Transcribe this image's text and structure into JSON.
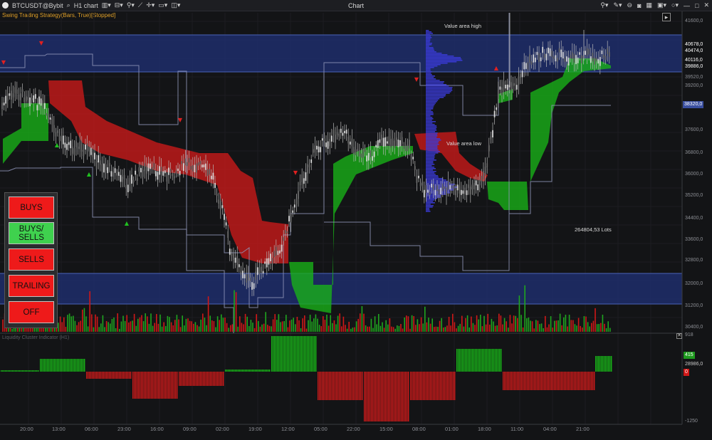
{
  "toolbar": {
    "symbol": "BTCUSDT@Bybit",
    "timeframe": "H1 chart",
    "window_title": "Chart"
  },
  "strategy_label": "Swing Trading Strategy(Bars, True)[Stopped]",
  "colors": {
    "background": "#131416",
    "buy": "#18b418",
    "sell": "#cc1a1a",
    "value_area": "#1e2d6b",
    "profile": "#3b3bd9",
    "level_line": "#4a62b8"
  },
  "annotations": {
    "value_area_high": "Value area high",
    "value_area_low": "Value area low",
    "lots": "264804,53 Lots"
  },
  "price_axis": {
    "ticks": [
      "41600,0",
      "39520,0",
      "39200,0",
      "37600,0",
      "36800,0",
      "36000,0",
      "35200,0",
      "34400,0",
      "33600,0",
      "32800,0",
      "32000,0",
      "31200,0",
      "30400,0"
    ],
    "levels": [
      "40678,0",
      "40474,0",
      "40116,0",
      "39886,0"
    ],
    "current_price": "38320,0"
  },
  "indicator_axis": {
    "top": "918",
    "current": "415",
    "mid": "28986,0",
    "zero": "0",
    "bottom": "-1250"
  },
  "time_axis": [
    "20:00",
    "13:00",
    "06:00",
    "23:00",
    "16:00",
    "09:00",
    "02:00",
    "19:00",
    "12:00",
    "05:00",
    "22:00",
    "15:00",
    "08:00",
    "01:00",
    "18:00",
    "11:00",
    "04:00",
    "21:00"
  ],
  "control_buttons": [
    {
      "label": "BUYS",
      "state": "off"
    },
    {
      "label": "BUYS/ SELLS",
      "state": "on"
    },
    {
      "label": "SELLS",
      "state": "off"
    },
    {
      "label": "TRAILING",
      "state": "off"
    },
    {
      "label": "OFF",
      "state": "off"
    }
  ],
  "indicator_subtitle": "Liquidity Cluster Indicator (H1)"
}
